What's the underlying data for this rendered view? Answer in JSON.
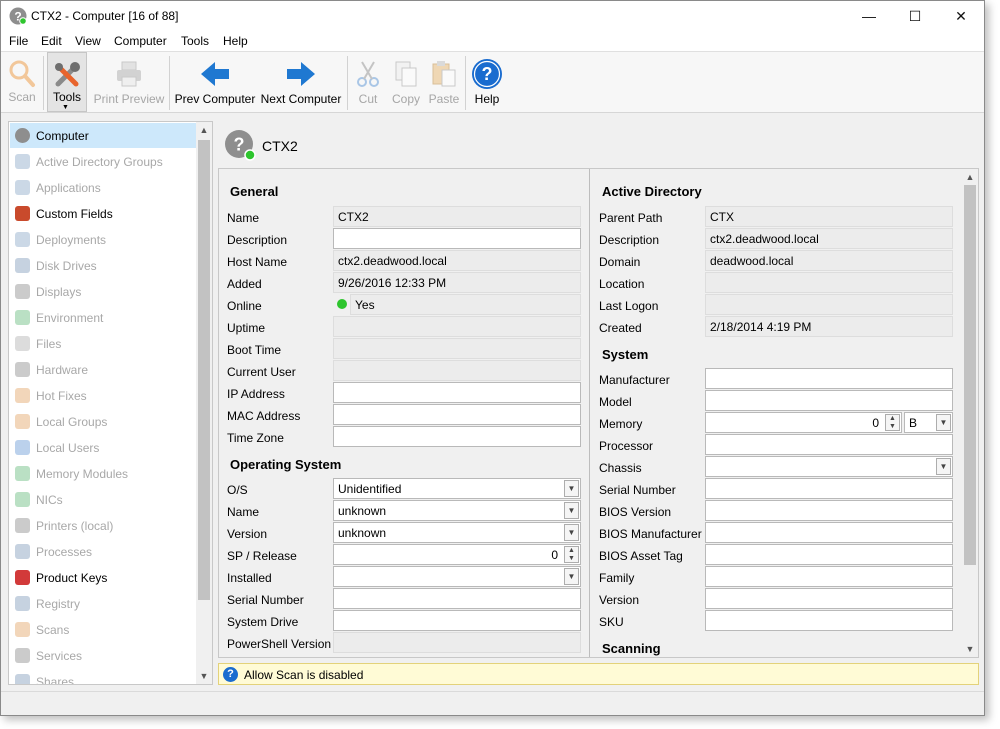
{
  "window": {
    "title": "CTX2 - Computer [16 of 88]",
    "minimize": "—",
    "maximize": "☐",
    "close": "✕"
  },
  "menu": [
    "File",
    "Edit",
    "View",
    "Computer",
    "Tools",
    "Help"
  ],
  "toolbar": {
    "scan": "Scan",
    "tools": "Tools",
    "print_preview": "Print Preview",
    "prev": "Prev Computer",
    "next": "Next Computer",
    "cut": "Cut",
    "copy": "Copy",
    "paste": "Paste",
    "help": "Help"
  },
  "sidebar": {
    "items": [
      {
        "label": "Computer",
        "icon": "question-icon",
        "state": "active"
      },
      {
        "label": "Active Directory Groups",
        "icon": "ad-groups-icon",
        "state": "dim"
      },
      {
        "label": "Applications",
        "icon": "applications-icon",
        "state": "dim"
      },
      {
        "label": "Custom Fields",
        "icon": "database-icon",
        "state": "normal"
      },
      {
        "label": "Deployments",
        "icon": "deployments-icon",
        "state": "dim"
      },
      {
        "label": "Disk Drives",
        "icon": "disk-icon",
        "state": "dim"
      },
      {
        "label": "Displays",
        "icon": "monitor-icon",
        "state": "dim"
      },
      {
        "label": "Environment",
        "icon": "environment-icon",
        "state": "dim"
      },
      {
        "label": "Files",
        "icon": "file-icon",
        "state": "dim"
      },
      {
        "label": "Hardware",
        "icon": "wrench-icon",
        "state": "dim"
      },
      {
        "label": "Hot Fixes",
        "icon": "hotfix-icon",
        "state": "dim"
      },
      {
        "label": "Local Groups",
        "icon": "group-icon",
        "state": "dim"
      },
      {
        "label": "Local Users",
        "icon": "user-icon",
        "state": "dim"
      },
      {
        "label": "Memory Modules",
        "icon": "memory-icon",
        "state": "dim"
      },
      {
        "label": "NICs",
        "icon": "nic-icon",
        "state": "dim"
      },
      {
        "label": "Printers (local)",
        "icon": "printer-icon",
        "state": "dim"
      },
      {
        "label": "Processes",
        "icon": "gears-icon",
        "state": "dim"
      },
      {
        "label": "Product Keys",
        "icon": "keys-icon",
        "state": "normal"
      },
      {
        "label": "Registry",
        "icon": "registry-icon",
        "state": "dim"
      },
      {
        "label": "Scans",
        "icon": "magnifier-icon",
        "state": "dim"
      },
      {
        "label": "Services",
        "icon": "services-icon",
        "state": "dim"
      },
      {
        "label": "Shares",
        "icon": "share-icon",
        "state": "dim"
      }
    ]
  },
  "header": {
    "name": "CTX2",
    "online_color": "#2ec52e"
  },
  "general": {
    "title": "General",
    "fields": {
      "name": {
        "label": "Name",
        "value": "CTX2"
      },
      "description": {
        "label": "Description",
        "value": ""
      },
      "host_name": {
        "label": "Host Name",
        "value": "ctx2.deadwood.local"
      },
      "added": {
        "label": "Added",
        "value": "9/26/2016 12:33 PM"
      },
      "online": {
        "label": "Online",
        "value": "Yes"
      },
      "uptime": {
        "label": "Uptime",
        "value": ""
      },
      "boot_time": {
        "label": "Boot Time",
        "value": ""
      },
      "current_user": {
        "label": "Current User",
        "value": ""
      },
      "ip_address": {
        "label": "IP Address",
        "value": ""
      },
      "mac_address": {
        "label": "MAC Address",
        "value": ""
      },
      "time_zone": {
        "label": "Time Zone",
        "value": ""
      }
    }
  },
  "os": {
    "title": "Operating System",
    "fields": {
      "os": {
        "label": "O/S",
        "value": "Unidentified"
      },
      "name": {
        "label": "Name",
        "value": "unknown"
      },
      "version": {
        "label": "Version",
        "value": "unknown"
      },
      "sp": {
        "label": "SP / Release",
        "value": "0"
      },
      "installed": {
        "label": "Installed",
        "value": ""
      },
      "serial": {
        "label": "Serial Number",
        "value": ""
      },
      "system_drive": {
        "label": "System Drive",
        "value": ""
      },
      "powershell": {
        "label": "PowerShell Version",
        "value": ""
      }
    }
  },
  "ad": {
    "title": "Active Directory",
    "fields": {
      "parent_path": {
        "label": "Parent Path",
        "value": "CTX"
      },
      "description": {
        "label": "Description",
        "value": "ctx2.deadwood.local"
      },
      "domain": {
        "label": "Domain",
        "value": "deadwood.local"
      },
      "location": {
        "label": "Location",
        "value": ""
      },
      "last_logon": {
        "label": "Last Logon",
        "value": ""
      },
      "created": {
        "label": "Created",
        "value": "2/18/2014 4:19 PM"
      }
    }
  },
  "system": {
    "title": "System",
    "fields": {
      "manufacturer": {
        "label": "Manufacturer",
        "value": ""
      },
      "model": {
        "label": "Model",
        "value": ""
      },
      "memory": {
        "label": "Memory",
        "value": "0",
        "unit": "B"
      },
      "processor": {
        "label": "Processor",
        "value": ""
      },
      "chassis": {
        "label": "Chassis",
        "value": ""
      },
      "serial": {
        "label": "Serial Number",
        "value": ""
      },
      "bios_version": {
        "label": "BIOS Version",
        "value": ""
      },
      "bios_manufacturer": {
        "label": "BIOS Manufacturer",
        "value": ""
      },
      "bios_asset": {
        "label": "BIOS Asset Tag",
        "value": ""
      },
      "family": {
        "label": "Family",
        "value": ""
      },
      "version": {
        "label": "Version",
        "value": ""
      },
      "sku": {
        "label": "SKU",
        "value": ""
      }
    }
  },
  "scanning": {
    "title": "Scanning"
  },
  "status": {
    "message": "Allow Scan is disabled"
  }
}
